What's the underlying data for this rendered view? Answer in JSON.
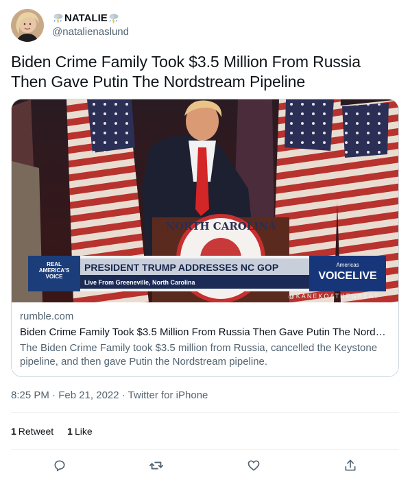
{
  "user": {
    "display_name": "NATALIE",
    "handle": "@natalienaslund",
    "name_emoji": "cloud-with-lightning-and-rain-icon"
  },
  "tweet": {
    "text": "Biden Crime Family Took $3.5 Million From Russia Then Gave Putin The Nordstream Pipeline"
  },
  "card": {
    "image": {
      "chyron_logo": [
        "REAL",
        "AMERICA'S",
        "VOICE"
      ],
      "chyron_headline": "PRESIDENT TRUMP ADDRESSES NC GOP",
      "chyron_subline": "Live From Greeneville, North Carolina",
      "network_small": "Americas",
      "network_big": "VOICELIVE",
      "podium_text": "NORTH CAROLINA",
      "watermark": "@KANEKOATHEGREAT"
    },
    "domain": "rumble.com",
    "title": "Biden Crime Family Took $3.5 Million From Russia Then Gave Putin The Nordst...",
    "description": "The Biden Crime Family took $3.5 million from Russia, cancelled the Keystone pipeline, and then gave Putin the Nordstream pipeline."
  },
  "meta": {
    "timestamp": "8:25 PM · Feb 21, 2022 · Twitter for iPhone"
  },
  "stats": {
    "retweets_count": "1",
    "retweets_label": "Retweet",
    "likes_count": "1",
    "likes_label": "Like"
  },
  "actions": [
    "reply-icon",
    "retweet-icon",
    "like-icon",
    "share-icon"
  ],
  "colors": {
    "text_primary": "#0f1419",
    "text_secondary": "#536471",
    "border": "#cfd9de",
    "divider": "#eff3f4"
  }
}
